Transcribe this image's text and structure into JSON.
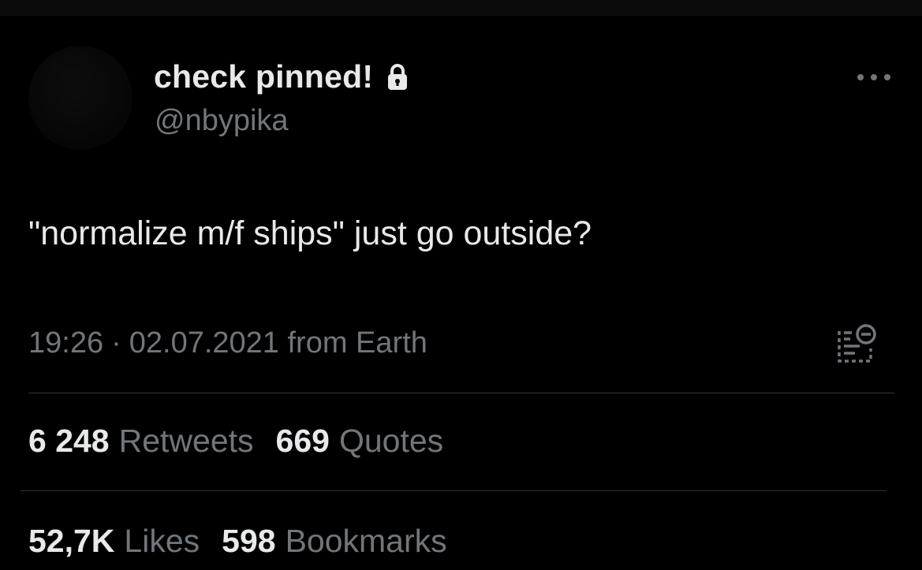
{
  "user": {
    "display_name": "check pinned!",
    "handle": "@nbypika",
    "lock_icon": "lock-icon"
  },
  "tweet": {
    "text": "\"normalize m/f ships\" just go outside?",
    "time": "19:26",
    "separator": "·",
    "date": "02.07.2021",
    "source": "from Earth"
  },
  "stats": {
    "retweets": {
      "count": "6 248",
      "label": "Retweets"
    },
    "quotes": {
      "count": "669",
      "label": "Quotes"
    },
    "likes": {
      "count": "52,7K",
      "label": "Likes"
    },
    "bookmarks": {
      "count": "598",
      "label": "Bookmarks"
    }
  },
  "icons": {
    "more": "more-options-icon",
    "activity": "view-activity-icon"
  },
  "colors": {
    "background": "#000000",
    "primary_text": "#e7e9ea",
    "secondary_text": "#71767b",
    "divider": "#2f3336"
  }
}
